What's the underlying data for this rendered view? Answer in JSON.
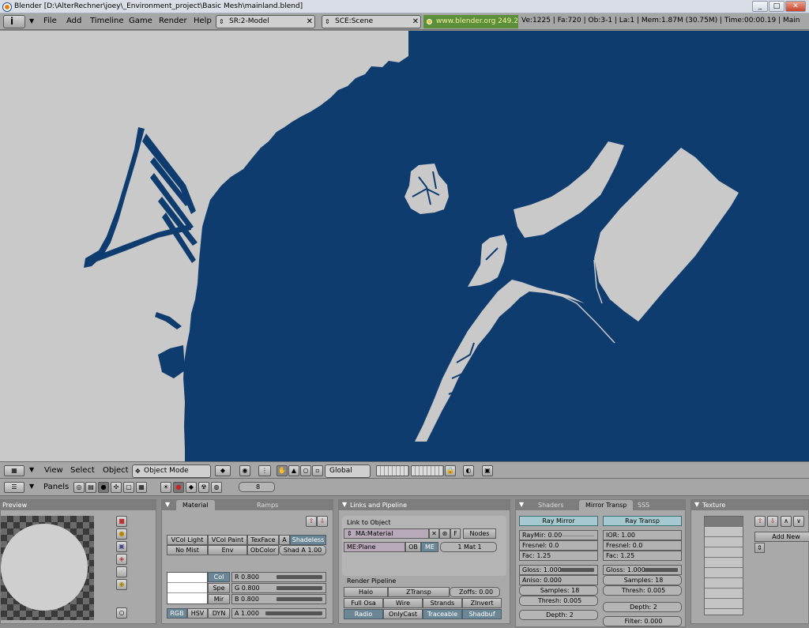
{
  "window": {
    "title": "Blender [D:\\AlterRechner\\joey\\_Environment_project\\Basic Mesh\\mainland.blend]",
    "controls": [
      "_",
      "□",
      "✕"
    ]
  },
  "infobar": {
    "menus": [
      "File",
      "Add",
      "Timeline",
      "Game",
      "Render",
      "Help"
    ],
    "screen": "SR:2-Model",
    "scene": "SCE:Scene",
    "url": "www.blender.org 249.2",
    "stats": "Ve:1225 | Fa:720 | Ob:3-1 | La:1  | Mem:1.87M (30.75M) | Time:00:00.19 | Main"
  },
  "view_header": {
    "menus": [
      "View",
      "Select",
      "Object"
    ],
    "mode": "Object Mode",
    "orientation": "Global"
  },
  "buttons_header": {
    "label": "Panels",
    "frame": "8"
  },
  "preview": {
    "title": "Preview"
  },
  "material_panel": {
    "tab_active": "Material",
    "tab_other": "Ramps",
    "row1": [
      "VCol Light",
      "VCol Paint",
      "TexFace",
      "A",
      "Shadeless"
    ],
    "row2": [
      "No Mist",
      "Env",
      "ObColor",
      "Shad A 1.00"
    ],
    "color_buttons": [
      "Col",
      "Spe",
      "Mir"
    ],
    "rgb": [
      "R 0.800",
      "G 0.800",
      "B 0.800"
    ],
    "modes": [
      "RGB",
      "HSV",
      "DYN"
    ],
    "alpha": "A 1.000",
    "alpha_value": 1.0,
    "rgb_values": [
      0.8,
      0.8,
      0.8
    ]
  },
  "links_panel": {
    "title": "Links and Pipeline",
    "link_label": "Link to Object",
    "material": "MA:Material",
    "f": "F",
    "nodes": "Nodes",
    "mesh": "ME:Plane",
    "ob": "OB",
    "me": "ME",
    "mat_index": "1 Mat 1",
    "pipeline_label": "Render Pipeline",
    "pipe_row1": [
      "Halo",
      "ZTransp",
      "Zoffs: 0.00"
    ],
    "pipe_row2": [
      "Full Osa",
      "Wire",
      "Strands",
      "ZInvert"
    ],
    "pipe_row3": [
      "Radio",
      "OnlyCast",
      "Traceable",
      "Shadbuf"
    ]
  },
  "shaders_panel": {
    "tab_inactive": "Shaders",
    "tab_active": "Mirror Transp",
    "tab_other": "SSS",
    "ray_mirror": "Ray Mirror",
    "ray_transp": "Ray Transp",
    "left": [
      "RayMir: 0.00",
      "Fresnel: 0.0",
      "Fac: 1.25",
      "Gloss: 1.000",
      "Aniso: 0.000",
      "Samples: 18",
      "Thresh: 0.005",
      "Depth: 2"
    ],
    "right": [
      "IOR: 1.00",
      "Fresnel: 0.0",
      "Fac: 1.25",
      "Gloss: 1.000",
      "Samples: 18",
      "Thresh: 0.005",
      "Depth: 2",
      "Filter: 0.000"
    ]
  },
  "texture_panel": {
    "title": "Texture",
    "add_new": "Add New"
  }
}
